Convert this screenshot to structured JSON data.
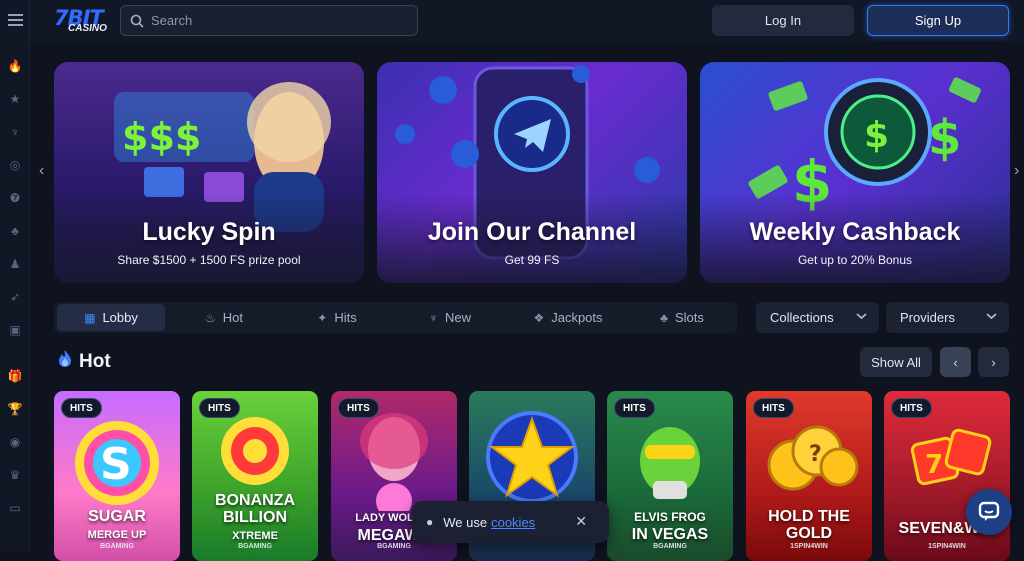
{
  "header": {
    "logo_text": "7BIT",
    "logo_sub": "CASINO",
    "search_placeholder": "Search",
    "login_label": "Log In",
    "signup_label": "Sign Up"
  },
  "sidebar": {
    "icons": [
      "menu-icon",
      "fire-icon",
      "star-icon",
      "hits-icon",
      "target-icon",
      "slots-icon",
      "cherry-icon",
      "live-dealer-icon",
      "rocket-icon",
      "cards-icon",
      "gift-icon",
      "trophy-icon",
      "vip-icon",
      "crown-icon",
      "wallet-icon"
    ]
  },
  "banners": [
    {
      "title": "Lucky Spin",
      "subtitle": "Share $1500 + 1500 FS prize pool"
    },
    {
      "title": "Join Our Channel",
      "subtitle": "Get 99 FS"
    },
    {
      "title": "Weekly Cashback",
      "subtitle": "Get up to 20% Bonus"
    }
  ],
  "tabs": [
    {
      "label": "Lobby",
      "icon": "lobby-icon",
      "active": true
    },
    {
      "label": "Hot",
      "icon": "fire-icon",
      "active": false
    },
    {
      "label": "Hits",
      "icon": "hits-icon",
      "active": false
    },
    {
      "label": "New",
      "icon": "new-icon",
      "active": false
    },
    {
      "label": "Jackpots",
      "icon": "jackpot-icon",
      "active": false
    },
    {
      "label": "Slots",
      "icon": "cherry-icon",
      "active": false
    }
  ],
  "filters": {
    "collections": "Collections",
    "providers": "Providers"
  },
  "section": {
    "title": "Hot",
    "show_all": "Show All"
  },
  "games": [
    {
      "badge": "HITS",
      "name": "SUGAR",
      "name2": "MERGE UP",
      "provider": "BGAMING"
    },
    {
      "badge": "HITS",
      "name": "BONANZA",
      "name2": "BILLION",
      "name3": "XTREME",
      "provider": "BGAMING"
    },
    {
      "badge": "HITS",
      "name": "LADY WOLF M",
      "name2": "MEGAWA",
      "provider": "BGAMING"
    },
    {
      "badge": "",
      "name": "",
      "provider": ""
    },
    {
      "badge": "HITS",
      "name": "ELVIS FROG",
      "name2": "IN VEGAS",
      "provider": "BGAMING"
    },
    {
      "badge": "HITS",
      "name": "HOLD THE",
      "name2": "GOLD",
      "provider": "1SPIN4WIN"
    },
    {
      "badge": "HITS",
      "name": "SEVEN&WIN",
      "provider": "1SPIN4WIN"
    }
  ],
  "cookie": {
    "text": "We use",
    "link": "cookies"
  },
  "colors": {
    "accent": "#2d7bff",
    "background": "#0f1320",
    "panel": "#171c2b"
  }
}
